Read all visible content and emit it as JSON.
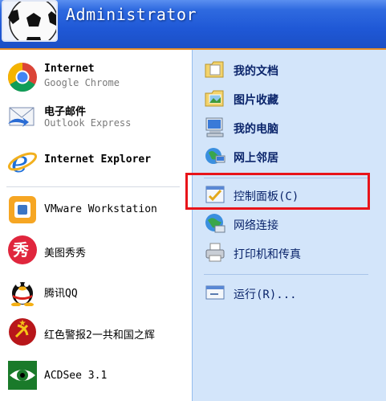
{
  "user": {
    "name": "Administrator",
    "avatar_icon": "soccer-ball-icon"
  },
  "pinned": [
    {
      "title": "Internet",
      "subtitle": "Google Chrome",
      "icon": "chrome-icon"
    },
    {
      "title": "电子邮件",
      "subtitle": "Outlook Express",
      "icon": "outlook-express-icon"
    },
    {
      "title": "Internet Explorer",
      "icon": "internet-explorer-icon"
    }
  ],
  "recent": [
    {
      "title": "VMware Workstation",
      "icon": "vmware-icon"
    },
    {
      "title": "美图秀秀",
      "icon": "meitu-icon"
    },
    {
      "title": "腾讯QQ",
      "icon": "qq-penguin-icon"
    },
    {
      "title": "红色警报2一共和国之辉",
      "icon": "red-alert-icon"
    },
    {
      "title": "ACDSee 3.1",
      "icon": "acdsee-eye-icon"
    }
  ],
  "places": [
    {
      "label": "我的文档",
      "icon": "my-documents-folder-icon"
    },
    {
      "label": "图片收藏",
      "icon": "my-pictures-folder-icon"
    },
    {
      "label": "我的电脑",
      "icon": "my-computer-icon"
    },
    {
      "label": "网上邻居",
      "icon": "network-places-icon"
    }
  ],
  "system": [
    {
      "label": "控制面板(C)",
      "icon": "control-panel-icon"
    },
    {
      "label": "网络连接",
      "icon": "network-connections-icon"
    },
    {
      "label": "打印机和传真",
      "icon": "printer-icon"
    }
  ],
  "run": {
    "label": "运行(R)...",
    "icon": "run-icon"
  },
  "colors": {
    "highlight_border": "#e8141a",
    "header_blue": "#1f58d6",
    "right_pane": "#d3e5fa"
  }
}
